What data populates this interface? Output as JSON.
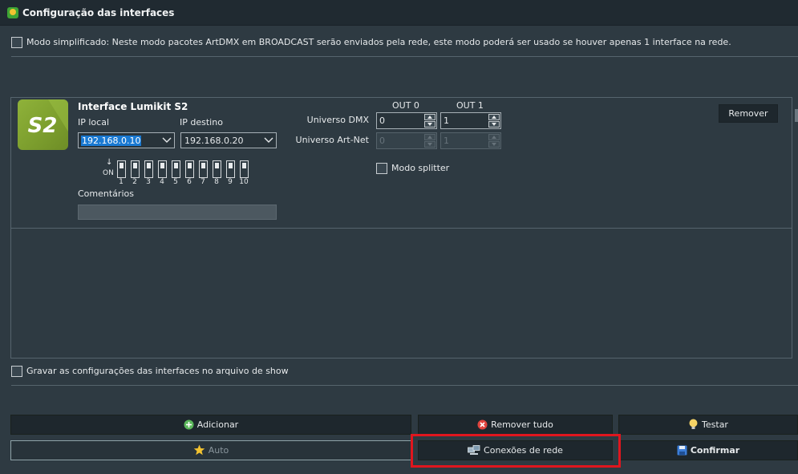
{
  "window": {
    "title": "Configuração das interfaces",
    "icon": "app-logo-icon"
  },
  "simplified_mode": {
    "label": "Modo simplificado: Neste modo pacotes ArtDMX em BROADCAST serão enviados pela rede, este modo poderá ser usado se houver apenas 1 interface na rede.",
    "checked": false
  },
  "interface": {
    "logo_text": "S2",
    "name": "Interface Lumikit S2",
    "ip_local_label": "IP local",
    "ip_local_value": "192.168.0.10",
    "ip_dest_label": "IP destino",
    "ip_dest_value": "192.168.0.20",
    "dip_arrow": "↓",
    "dip_on_label": "ON",
    "dip_numbers": [
      "1",
      "2",
      "3",
      "4",
      "5",
      "6",
      "7",
      "8",
      "9",
      "10"
    ],
    "comments_label": "Comentários",
    "comments_value": "",
    "out0_label": "OUT 0",
    "out1_label": "OUT 1",
    "universe_dmx_label": "Universo DMX",
    "universe_artnet_label": "Universo Art-Net",
    "out0_dmx": "0",
    "out1_dmx": "1",
    "out0_artnet": "0",
    "out1_artnet": "1",
    "splitter_label": "Modo splitter",
    "splitter_checked": false,
    "remove_label": "Remover"
  },
  "save_config": {
    "label": "Gravar as configurações das interfaces no arquivo de show",
    "checked": false
  },
  "buttons": {
    "add": "Adicionar",
    "remove_all": "Remover tudo",
    "test": "Testar",
    "auto": "Auto",
    "network_connections": "Conexões de rede",
    "confirm": "Confirmar"
  },
  "colors": {
    "highlight": "#e0161e",
    "accent_green": "#8fb23a",
    "selection": "#1979d2"
  }
}
